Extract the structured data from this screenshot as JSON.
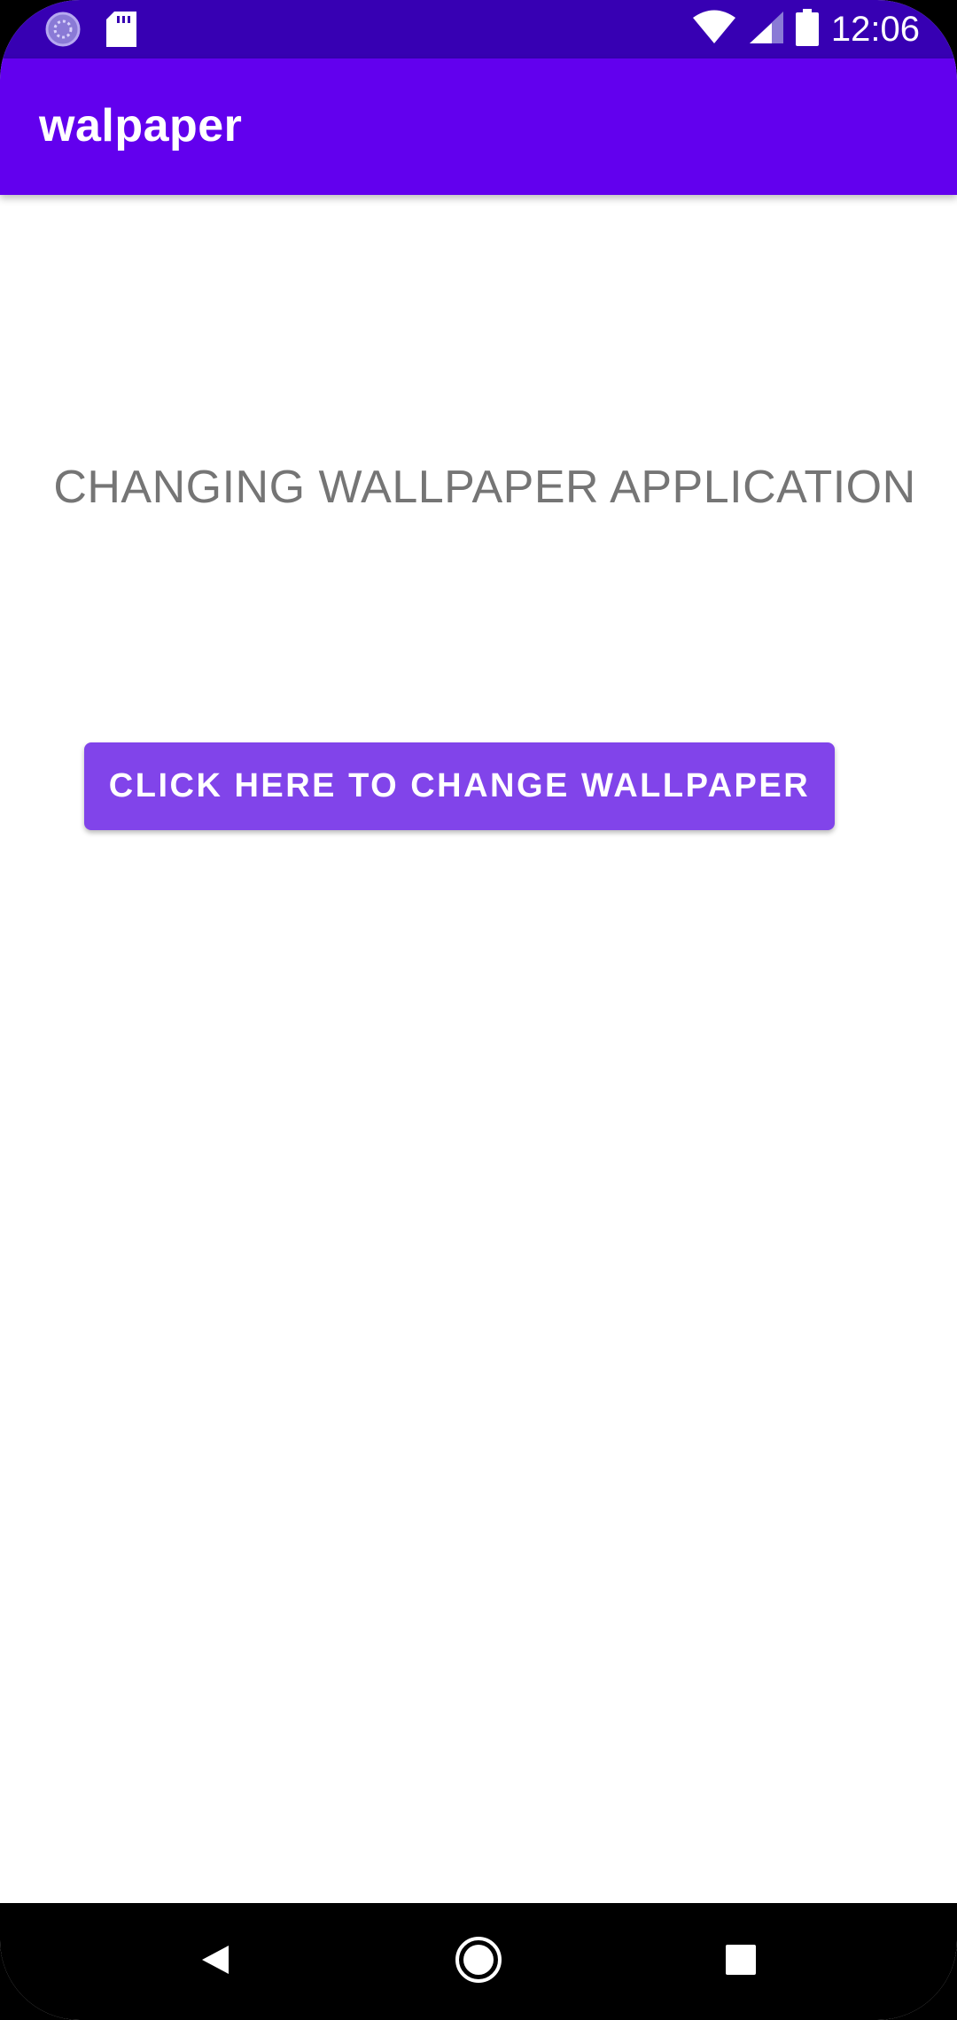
{
  "status_bar": {
    "time": "12:06",
    "icons": [
      "loading-icon",
      "sd-card-icon",
      "wifi-icon",
      "signal-icon",
      "battery-icon"
    ],
    "background": "#3700B3"
  },
  "app_bar": {
    "title": "walpaper",
    "background": "#6200EE"
  },
  "main": {
    "headline": "CHANGING WALLPAPER APPLICATION",
    "button_label": "CLICK HERE TO CHANGE WALLPAPER",
    "button_color": "#8144EA"
  },
  "nav_bar": {
    "buttons": [
      "back-icon",
      "home-icon",
      "recents-icon"
    ]
  }
}
